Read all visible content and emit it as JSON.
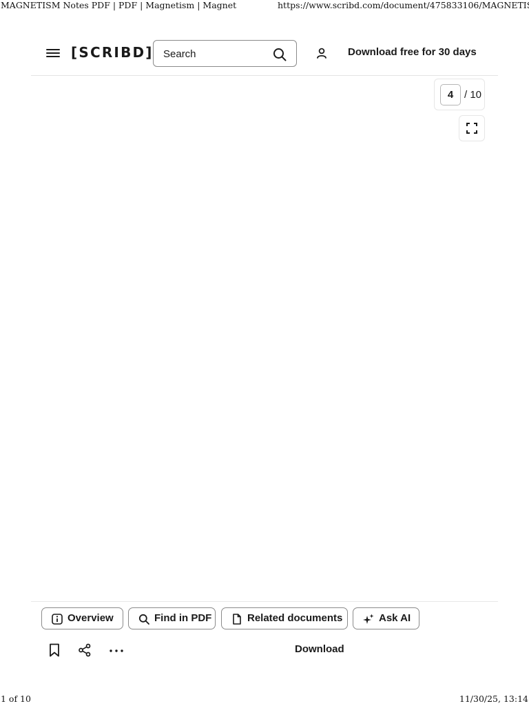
{
  "print_header": {
    "title": "MAGNETISM Notes PDF | PDF | Magnetism | Magnet",
    "url": "https://www.scribd.com/document/475833106/MAGNETISM..."
  },
  "topbar": {
    "menu_icon": "hamburger-menu-icon",
    "logo": "[SCRIBD]",
    "search_placeholder": "Search",
    "search_icon": "search-icon",
    "user_icon": "user-icon",
    "download_free": "Download free for 30 days"
  },
  "viewer": {
    "current_page": "4",
    "total_pages": "/ 10",
    "fullscreen_icon": "fullscreen-icon"
  },
  "bottom_tabs": [
    {
      "label": "Overview",
      "icon": "info-icon"
    },
    {
      "label": "Find in PDF",
      "icon": "search-icon"
    },
    {
      "label": "Related documents",
      "icon": "document-icon"
    },
    {
      "label": "Ask AI",
      "icon": "sparkle-icon"
    }
  ],
  "actions": {
    "bookmark_icon": "bookmark-icon",
    "share_icon": "share-icon",
    "more_icon": "more-icon",
    "download_label": "Download"
  },
  "print_footer": {
    "page": "1 of 10",
    "datetime": "11/30/25, 13:14"
  }
}
